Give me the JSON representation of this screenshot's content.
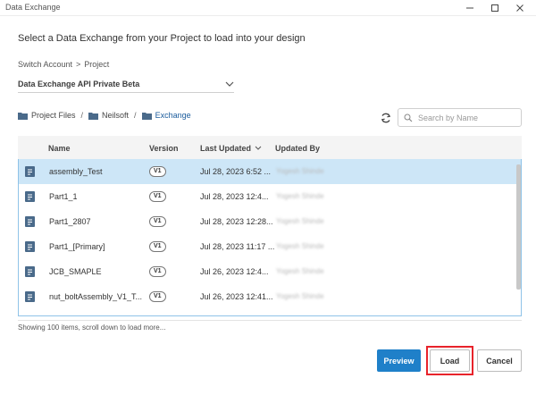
{
  "window": {
    "title": "Data Exchange"
  },
  "header": {
    "subtitle": "Select a Data Exchange from your Project to load into your design"
  },
  "breadcrumb_top": {
    "items": [
      "Switch Account",
      ">",
      "Project"
    ]
  },
  "project_select": {
    "value": "Data Exchange API Private Beta"
  },
  "path": {
    "items": [
      "Project Files",
      "Neilsoft",
      "Exchange"
    ]
  },
  "search": {
    "placeholder": "Search by Name"
  },
  "table": {
    "columns": [
      "Name",
      "Version",
      "Last Updated",
      "Updated By"
    ],
    "rows": [
      {
        "name": "assembly_Test",
        "version": "V1",
        "updated": "Jul 28, 2023 6:52 ...",
        "by": "Yogesh Shinde"
      },
      {
        "name": "Part1_1",
        "version": "V1",
        "updated": "Jul 28, 2023 12:4...",
        "by": "Yogesh Shinde"
      },
      {
        "name": "Part1_2807",
        "version": "V1",
        "updated": "Jul 28, 2023 12:28...",
        "by": "Yogesh Shinde"
      },
      {
        "name": "Part1_[Primary]",
        "version": "V1",
        "updated": "Jul 28, 2023 11:17 ...",
        "by": "Yogesh Shinde"
      },
      {
        "name": "JCB_SMAPLE",
        "version": "V1",
        "updated": "Jul 26, 2023 12:4...",
        "by": "Yogesh Shinde"
      },
      {
        "name": "nut_boltAssembly_V1_T...",
        "version": "V1",
        "updated": "Jul 26, 2023 12:41...",
        "by": "Yogesh Shinde"
      }
    ]
  },
  "status": {
    "text": "Showing 100 items, scroll down to load more..."
  },
  "buttons": {
    "preview": "Preview",
    "load": "Load",
    "cancel": "Cancel"
  },
  "colors": {
    "accent": "#1f80c9",
    "selected_row": "#cde6f7",
    "highlight": "#e8232b",
    "folder": "#4a6a8a"
  }
}
